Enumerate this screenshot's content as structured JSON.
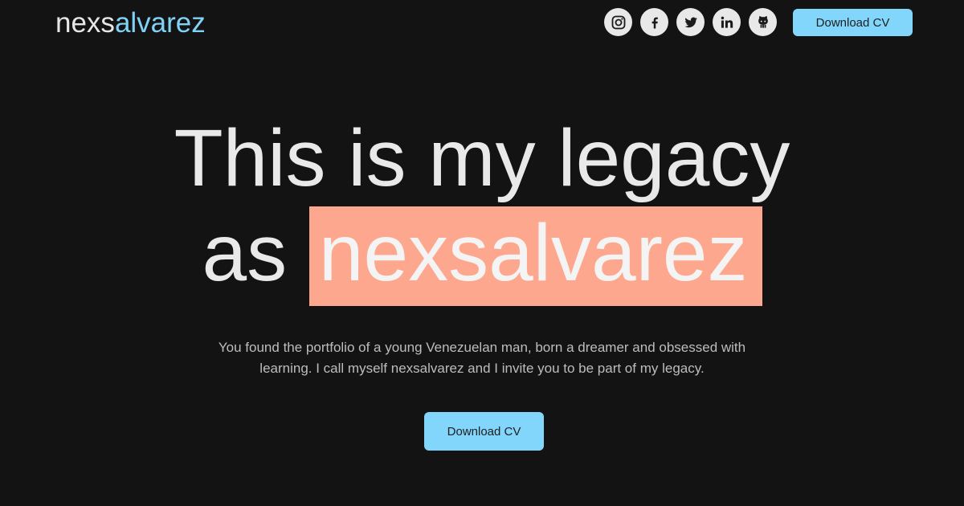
{
  "header": {
    "logo_prefix": "nexs",
    "logo_accent": "alvarez",
    "socials": [
      {
        "icon": "instagram-icon"
      },
      {
        "icon": "facebook-icon"
      },
      {
        "icon": "twitter-icon"
      },
      {
        "icon": "linkedin-icon"
      },
      {
        "icon": "github-icon"
      }
    ],
    "cv_button_label": "Download CV"
  },
  "hero": {
    "title_line1": "This is my legacy",
    "title_line2_prefix": "as",
    "title_highlight": "nexsalvarez",
    "description": "You found the portfolio of a young Venezuelan man, born a dreamer and obsessed with learning. I call myself nexsalvarez and I invite you to be part of my legacy.",
    "cta_label": "Download CV"
  },
  "colors": {
    "background": "#131313",
    "accent_blue": "#82d6fb",
    "highlight_salmon": "#fda88e",
    "text": "#e9e9e9"
  }
}
